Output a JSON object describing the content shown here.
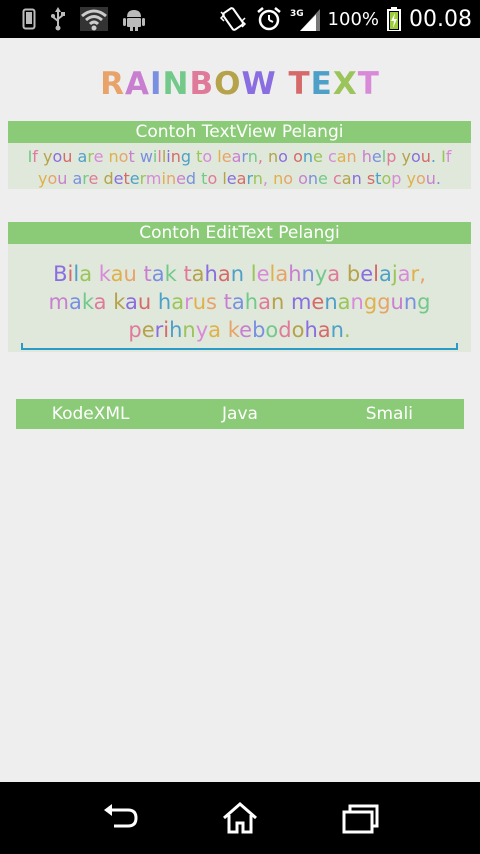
{
  "status_bar": {
    "battery_percent": "100%",
    "network": "3G",
    "time": "00.08",
    "left_icons": [
      "phone-icon",
      "usb-icon",
      "wifi-icon",
      "android-icon"
    ],
    "right_icons": [
      "vibrate-icon",
      "alarm-icon",
      "signal-icon",
      "battery-charging-icon"
    ]
  },
  "title": "RAINBOW TEXT",
  "textview_panel": {
    "header": "Contoh TextView Pelangi",
    "text": "If you are not willing to learn, no one can help you. If you are determined to learn, no one can stop you."
  },
  "edittext_panel": {
    "header": "Contoh EditText Pelangi",
    "value": "Bila kau tak tahan lelahnya belajar, maka kau harus tahan menanggung perihnya kebodohan."
  },
  "tabs": [
    "KodeXML",
    "Java",
    "Smali"
  ],
  "nav_bar": [
    "back-icon",
    "home-icon",
    "recent-apps-icon"
  ],
  "colors": {
    "background": "#eeeeee",
    "accent_green": "#8bcb78",
    "panel_bg": "#dfe8da",
    "edit_underline": "#2a9bc9"
  }
}
